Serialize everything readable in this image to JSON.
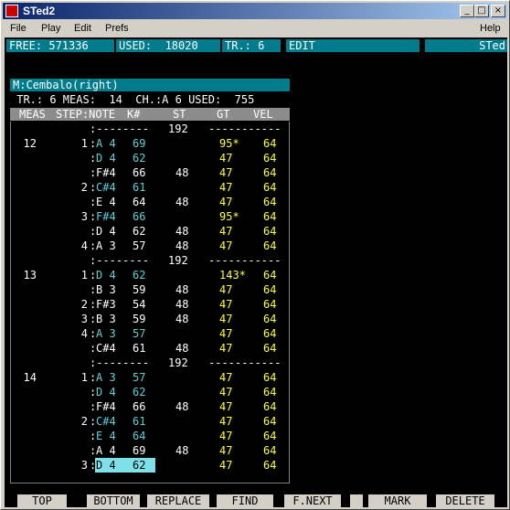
{
  "window": {
    "title": "STed2"
  },
  "titlebar_buttons": {
    "minimize": "_",
    "maximize": "□",
    "close": "×"
  },
  "menu": [
    "File",
    "Play",
    "Edit",
    "Prefs"
  ],
  "menu_help": "Help",
  "status": {
    "free": "FREE: 571336",
    "used": "USED:  18020",
    "track": "TR.: 6",
    "mode": "EDIT",
    "app": "STed"
  },
  "track": {
    "title": "M:Cembalo(right)",
    "info": " TR.: 6 MEAS:  14  CH.:A 6 USED:  755"
  },
  "columns": [
    "MEAS",
    "STEP:NOTE",
    "K#",
    "ST",
    "GT",
    "VEL"
  ],
  "rows": [
    {
      "meas": "",
      "step": "",
      "note": ":--------",
      "k": "",
      "st": "192",
      "gt": "-----------",
      "vel": "",
      "type": "sep"
    },
    {
      "meas": "12",
      "step": "1",
      "note": "A 4",
      "k": "69",
      "st": "",
      "gt": "95*",
      "vel": "64",
      "hl": true
    },
    {
      "meas": "",
      "step": "",
      "note": "D 4",
      "k": "62",
      "st": "",
      "gt": "47",
      "vel": "64",
      "hl": true
    },
    {
      "meas": "",
      "step": "",
      "note": "F#4",
      "k": "66",
      "st": "48",
      "gt": "47",
      "vel": "64",
      "hl": false
    },
    {
      "meas": "",
      "step": "2",
      "note": "C#4",
      "k": "61",
      "st": "",
      "gt": "47",
      "vel": "64",
      "hl": true
    },
    {
      "meas": "",
      "step": "",
      "note": "E 4",
      "k": "64",
      "st": "48",
      "gt": "47",
      "vel": "64",
      "hl": false
    },
    {
      "meas": "",
      "step": "3",
      "note": "F#4",
      "k": "66",
      "st": "",
      "gt": "95*",
      "vel": "64",
      "hl": true
    },
    {
      "meas": "",
      "step": "",
      "note": "D 4",
      "k": "62",
      "st": "48",
      "gt": "47",
      "vel": "64",
      "hl": false
    },
    {
      "meas": "",
      "step": "4",
      "note": "A 3",
      "k": "57",
      "st": "48",
      "gt": "47",
      "vel": "64",
      "hl": false
    },
    {
      "meas": "",
      "step": "",
      "note": ":--------",
      "k": "",
      "st": "192",
      "gt": "-----------",
      "vel": "",
      "type": "sep"
    },
    {
      "meas": "13",
      "step": "1",
      "note": "D 4",
      "k": "62",
      "st": "",
      "gt": "143*",
      "vel": "64",
      "hl": true
    },
    {
      "meas": "",
      "step": "",
      "note": "B 3",
      "k": "59",
      "st": "48",
      "gt": "47",
      "vel": "64",
      "hl": false
    },
    {
      "meas": "",
      "step": "2",
      "note": "F#3",
      "k": "54",
      "st": "48",
      "gt": "47",
      "vel": "64",
      "hl": false
    },
    {
      "meas": "",
      "step": "3",
      "note": "B 3",
      "k": "59",
      "st": "48",
      "gt": "47",
      "vel": "64",
      "hl": false
    },
    {
      "meas": "",
      "step": "4",
      "note": "A 3",
      "k": "57",
      "st": "",
      "gt": "47",
      "vel": "64",
      "hl": true
    },
    {
      "meas": "",
      "step": "",
      "note": "C#4",
      "k": "61",
      "st": "48",
      "gt": "47",
      "vel": "64",
      "hl": false
    },
    {
      "meas": "",
      "step": "",
      "note": ":--------",
      "k": "",
      "st": "192",
      "gt": "-----------",
      "vel": "",
      "type": "sep"
    },
    {
      "meas": "14",
      "step": "1",
      "note": "A 3",
      "k": "57",
      "st": "",
      "gt": "47",
      "vel": "64",
      "hl": true
    },
    {
      "meas": "",
      "step": "",
      "note": "D 4",
      "k": "62",
      "st": "",
      "gt": "47",
      "vel": "64",
      "hl": true
    },
    {
      "meas": "",
      "step": "",
      "note": "F#4",
      "k": "66",
      "st": "48",
      "gt": "47",
      "vel": "64",
      "hl": false
    },
    {
      "meas": "",
      "step": "2",
      "note": "C#4",
      "k": "61",
      "st": "",
      "gt": "47",
      "vel": "64",
      "hl": true
    },
    {
      "meas": "",
      "step": "",
      "note": "E 4",
      "k": "64",
      "st": "",
      "gt": "47",
      "vel": "64",
      "hl": true
    },
    {
      "meas": "",
      "step": "",
      "note": "A 4",
      "k": "69",
      "st": "48",
      "gt": "47",
      "vel": "64",
      "hl": false
    },
    {
      "meas": "",
      "step": "3",
      "note": "D 4",
      "k": "62",
      "st": "",
      "gt": "47",
      "vel": "64",
      "hl": true,
      "cursor": true
    }
  ],
  "fkeys": [
    "TOP",
    "BOTTOM",
    "REPLACE",
    "FIND",
    "F.NEXT",
    "",
    "MARK",
    "DELETE"
  ],
  "colors": {
    "status_bg": "#007c8c",
    "highlight": "#5ed0d8",
    "gate": "#ffff40",
    "cursor": "#7ee0e8"
  }
}
